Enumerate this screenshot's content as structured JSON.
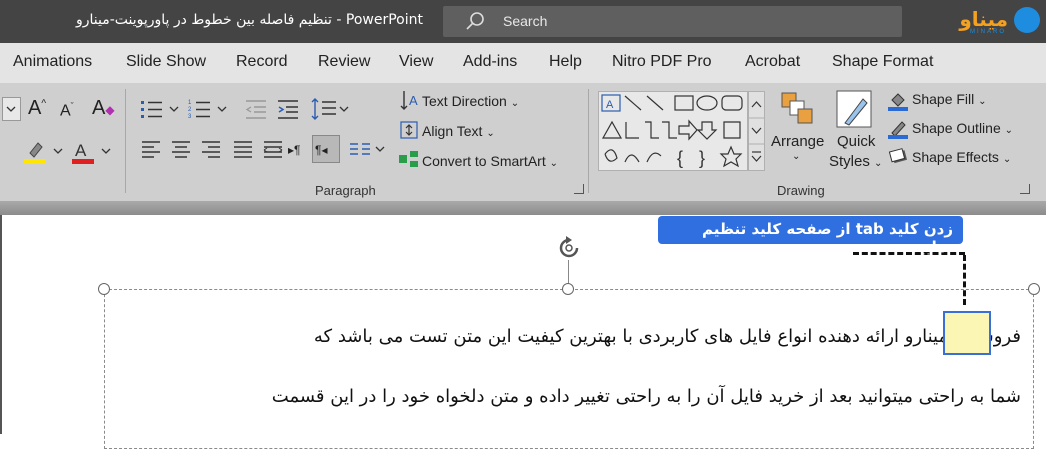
{
  "titlebar": {
    "doc_title": "تنظیم فاصله بین خطوط در پاورپوینت-مینارو",
    "separator": "-",
    "app_name": "PowerPoint",
    "search_placeholder": "Search",
    "logo_text": "میناو",
    "logo_sub": "MINARO"
  },
  "tabs": [
    "Animations",
    "Slide Show",
    "Record",
    "Review",
    "View",
    "Add-ins",
    "Help",
    "Nitro PDF Pro",
    "Acrobat",
    "Shape Format"
  ],
  "paragraph": {
    "group_label": "Paragraph",
    "text_direction": "Text Direction",
    "align_text": "Align Text",
    "convert_smartart": "Convert to SmartArt"
  },
  "drawing": {
    "group_label": "Drawing",
    "arrange": "Arrange",
    "quick": "Quick",
    "styles": "Styles",
    "shape_fill": "Shape Fill",
    "shape_outline": "Shape Outline",
    "shape_effects": "Shape Effects"
  },
  "document": {
    "callout": "زدن کلید tab از صفحه کلید تنظیم نمایید.",
    "line1": "فروشگاه مینارو ارائه دهنده انواع فایل های کاربردی با بهترین کیفیت این متن تست می باشد  که",
    "line2": "شما به راحتی میتوانید بعد از خرید فایل آن را به راحتی تغییر داده و متن دلخواه خود را در این قسمت"
  },
  "colors": {
    "titlebar": "#444444",
    "tabbar": "#e4e4e4",
    "ribbon": "#cfcfcf",
    "accent_blue": "#2f6fe0",
    "highlight_yellow": "#ffe600",
    "font_red": "#e02020"
  }
}
